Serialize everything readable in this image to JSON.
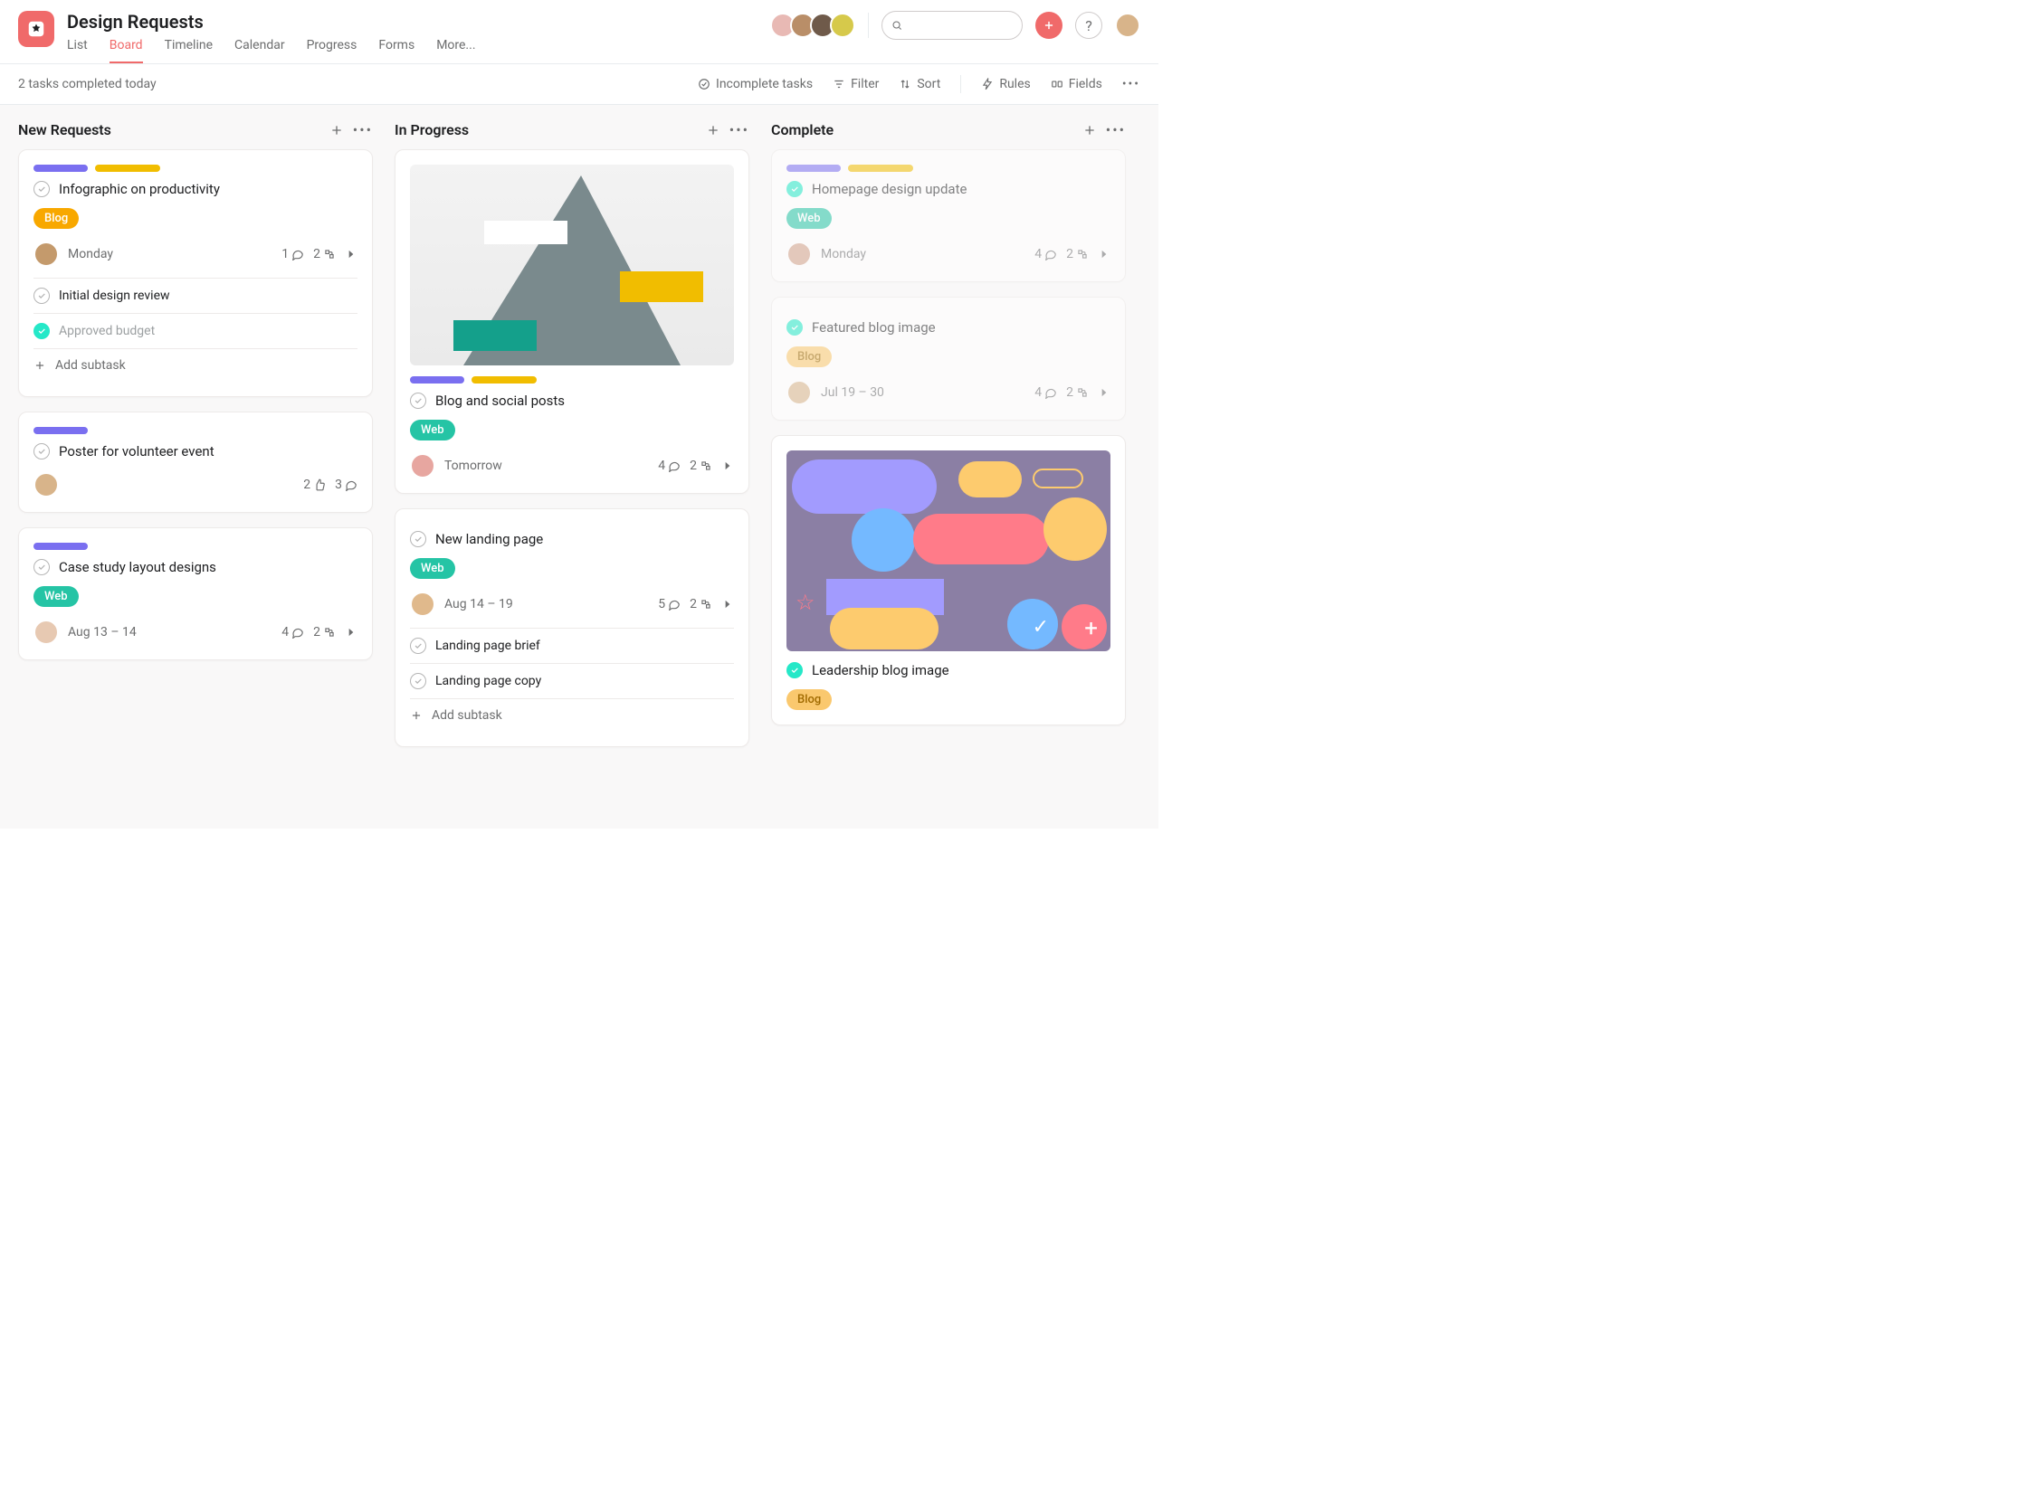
{
  "project": {
    "title": "Design Requests"
  },
  "tabs": [
    "List",
    "Board",
    "Timeline",
    "Calendar",
    "Progress",
    "Forms",
    "More..."
  ],
  "active_tab": "Board",
  "toolbar": {
    "status": "2 tasks completed today",
    "incomplete": "Incomplete tasks",
    "filter": "Filter",
    "sort": "Sort",
    "rules": "Rules",
    "fields": "Fields"
  },
  "search_placeholder": "",
  "columns": [
    {
      "title": "New Requests",
      "cards": [
        {
          "tags": [
            "purple",
            "yellow"
          ],
          "title": "Infographic on productivity",
          "chip": {
            "label": "Blog",
            "style": "orange"
          },
          "avatar": "#c49a6c",
          "date": "Monday",
          "stats": [
            {
              "n": "1",
              "i": "comment"
            },
            {
              "n": "2",
              "i": "subtask"
            }
          ],
          "arrow": true,
          "subs": [
            {
              "done": false,
              "txt": "Initial design review"
            },
            {
              "done": true,
              "approved": true,
              "txt": "Approved budget"
            },
            {
              "add": true,
              "txt": "Add subtask"
            }
          ]
        },
        {
          "tags": [
            "purple"
          ],
          "title": "Poster for volunteer event",
          "avatar": "#d8b48a",
          "stats": [
            {
              "n": "2",
              "i": "like"
            },
            {
              "n": "3",
              "i": "comment"
            }
          ]
        },
        {
          "tags": [
            "purple"
          ],
          "title": "Case study layout designs",
          "chip": {
            "label": "Web",
            "style": "teal"
          },
          "avatar": "#e7c9b2",
          "date": "Aug 13 – 14",
          "stats": [
            {
              "n": "4",
              "i": "comment"
            },
            {
              "n": "2",
              "i": "subtask"
            }
          ],
          "arrow": true
        }
      ]
    },
    {
      "title": "In Progress",
      "cards": [
        {
          "image": "mountain",
          "tags": [
            "purple",
            "yellow"
          ],
          "title": "Blog and social posts",
          "chip": {
            "label": "Web",
            "style": "teal"
          },
          "avatar": "#e7a6a0",
          "date": "Tomorrow",
          "stats": [
            {
              "n": "4",
              "i": "comment"
            },
            {
              "n": "2",
              "i": "subtask"
            }
          ],
          "arrow": true
        },
        {
          "title": "New landing page",
          "chip": {
            "label": "Web",
            "style": "teal"
          },
          "avatar": "#e0b98c",
          "date": "Aug 14 – 19",
          "stats": [
            {
              "n": "5",
              "i": "comment"
            },
            {
              "n": "2",
              "i": "subtask"
            }
          ],
          "arrow": true,
          "subs": [
            {
              "done": false,
              "txt": "Landing page brief"
            },
            {
              "done": false,
              "txt": "Landing page copy"
            },
            {
              "add": true,
              "txt": "Add subtask"
            }
          ]
        }
      ]
    },
    {
      "title": "Complete",
      "cards": [
        {
          "faded": true,
          "tags": [
            "purple",
            "yellow"
          ],
          "done": true,
          "title": "Homepage design update",
          "chip": {
            "label": "Web",
            "style": "teal"
          },
          "avatar": "#d2a18a",
          "date": "Monday",
          "stats": [
            {
              "n": "4",
              "i": "comment"
            },
            {
              "n": "2",
              "i": "subtask"
            }
          ],
          "arrow": true
        },
        {
          "faded": true,
          "done": true,
          "title": "Featured blog image",
          "chip": {
            "label": "Blog",
            "style": "orange-muted"
          },
          "avatar": "#d8b48a",
          "date": "Jul 19 – 30",
          "stats": [
            {
              "n": "4",
              "i": "comment"
            },
            {
              "n": "2",
              "i": "subtask"
            }
          ],
          "arrow": true
        },
        {
          "image": "abstract",
          "done": true,
          "title": "Leadership blog image",
          "chip": {
            "label": "Blog",
            "style": "orange-muted"
          }
        }
      ]
    }
  ],
  "avatar_colors": [
    "#e8b9b4",
    "#b98e68",
    "#6f5a4a",
    "#d6c94b"
  ],
  "me_avatar": "#d8b48a"
}
